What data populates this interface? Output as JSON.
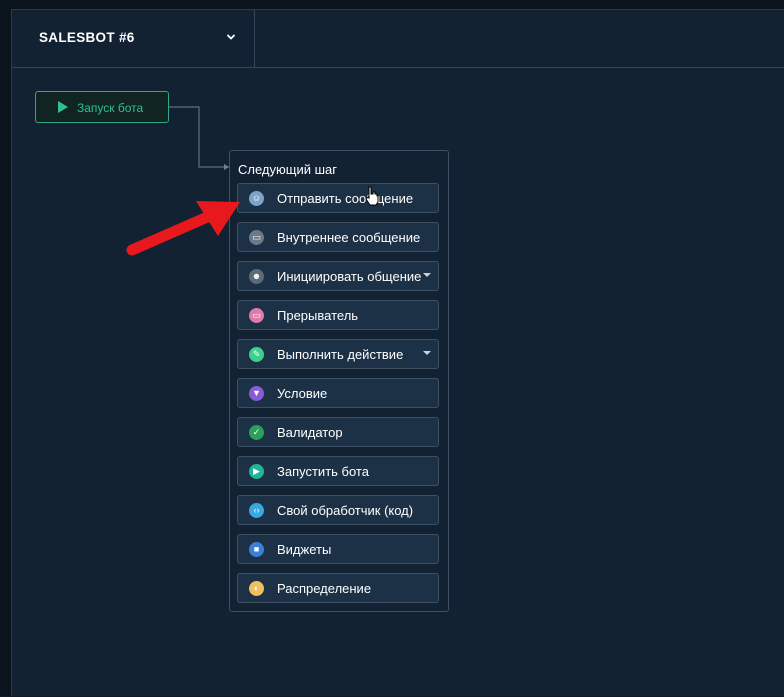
{
  "header": {
    "bot_name": "SALESBOT #6"
  },
  "start_node": {
    "label": "Запуск бота"
  },
  "panel": {
    "title": "Следующий шаг",
    "steps": [
      {
        "label": "Отправить сообщение",
        "icon": "message-avatar-icon",
        "color": "#7fa3c8",
        "dropdown": false
      },
      {
        "label": "Внутреннее сообщение",
        "icon": "chat-bubble-icon",
        "color": "#6b7a88",
        "dropdown": false
      },
      {
        "label": "Инициировать общение",
        "icon": "robot-icon",
        "color": "#5b6b78",
        "dropdown": true
      },
      {
        "label": "Прерыватель",
        "icon": "chat-bubble-icon",
        "color": "#e07aaa",
        "dropdown": false
      },
      {
        "label": "Выполнить действие",
        "icon": "pencil-icon",
        "color": "#3ed08f",
        "dropdown": true
      },
      {
        "label": "Условие",
        "icon": "filter-icon",
        "color": "#8a5bd6",
        "dropdown": false
      },
      {
        "label": "Валидатор",
        "icon": "checkmark-icon",
        "color": "#2aa05a",
        "dropdown": false
      },
      {
        "label": "Запустить бота",
        "icon": "play-icon",
        "color": "#20b596",
        "dropdown": false
      },
      {
        "label": "Свой обработчик (код)",
        "icon": "code-icon",
        "color": "#39a7e0",
        "dropdown": false
      },
      {
        "label": "Виджеты",
        "icon": "widget-icon",
        "color": "#3c7fd8",
        "dropdown": false
      },
      {
        "label": "Распределение",
        "icon": "distribution-icon",
        "color": "#f0c060",
        "dropdown": false
      }
    ]
  }
}
